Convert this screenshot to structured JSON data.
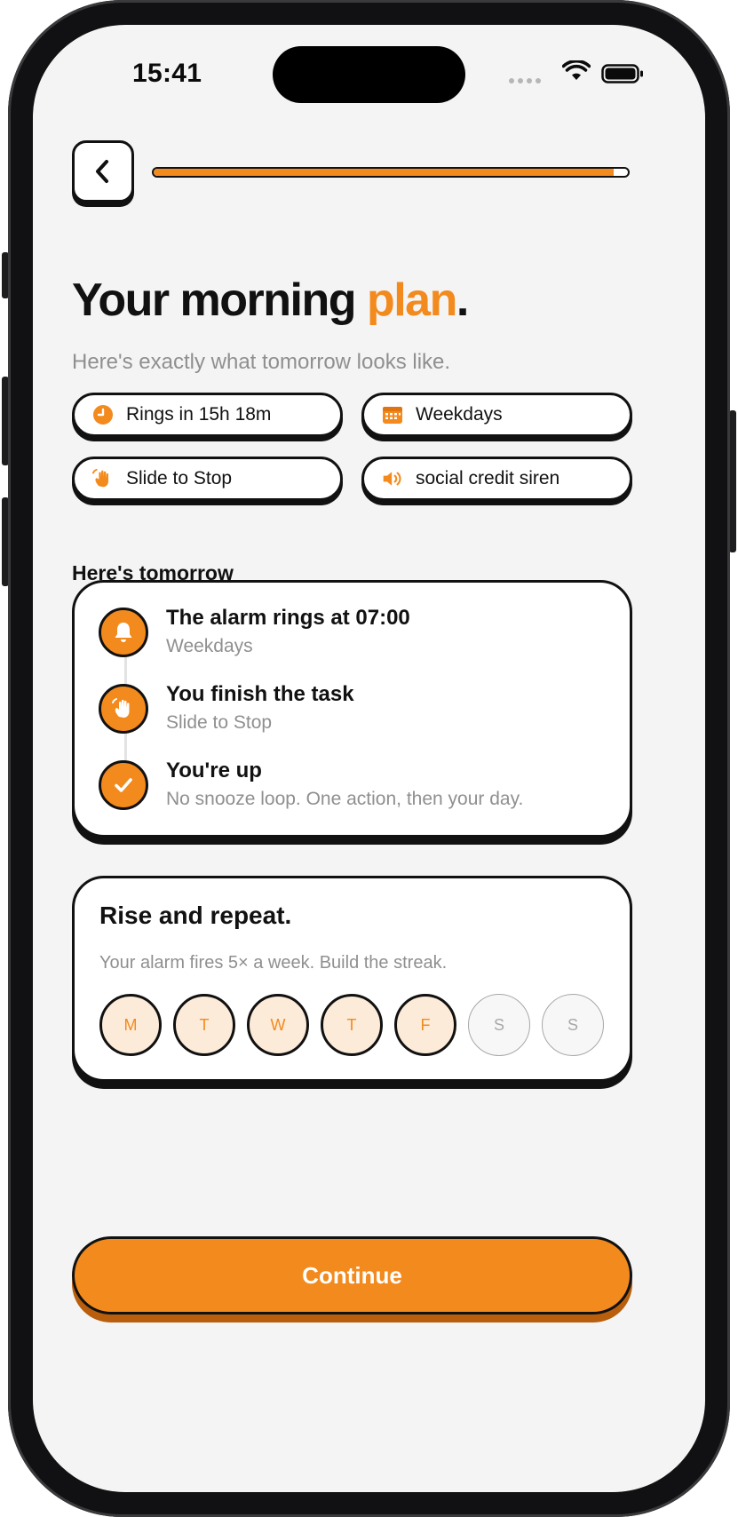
{
  "status_bar": {
    "time": "15:41"
  },
  "header": {
    "progress": 0.97
  },
  "title": {
    "main": "Your morning ",
    "accent": "plan",
    "end": "."
  },
  "subtitle": "Here's exactly what tomorrow looks like.",
  "chips": [
    {
      "icon": "clock-icon",
      "label": "Rings in 15h 18m"
    },
    {
      "icon": "calendar-icon",
      "label": "Weekdays"
    },
    {
      "icon": "swipe-hand-icon",
      "label": "Slide to Stop"
    },
    {
      "icon": "speaker-icon",
      "label": "social credit siren"
    }
  ],
  "section_label": "Here's tomorrow",
  "timeline": [
    {
      "icon": "bell-icon",
      "title": "The alarm rings at 07:00",
      "subtitle": "Weekdays"
    },
    {
      "icon": "swipe-hand-icon",
      "title": "You finish the task",
      "subtitle": "Slide to Stop"
    },
    {
      "icon": "checkmark-icon",
      "title": "You're up",
      "subtitle": "No snooze loop. One action, then your day."
    }
  ],
  "streak": {
    "title": "Rise and repeat.",
    "subtitle": "Your alarm fires 5× a week. Build the streak.",
    "days": [
      {
        "label": "M",
        "active": true
      },
      {
        "label": "T",
        "active": true
      },
      {
        "label": "W",
        "active": true
      },
      {
        "label": "T",
        "active": true
      },
      {
        "label": "F",
        "active": true
      },
      {
        "label": "S",
        "active": false
      },
      {
        "label": "S",
        "active": false
      }
    ]
  },
  "continue_label": "Continue",
  "colors": {
    "accent": "#f28a1e",
    "ink": "#111111",
    "muted": "#8f8f8f",
    "background": "#f4f4f4"
  }
}
